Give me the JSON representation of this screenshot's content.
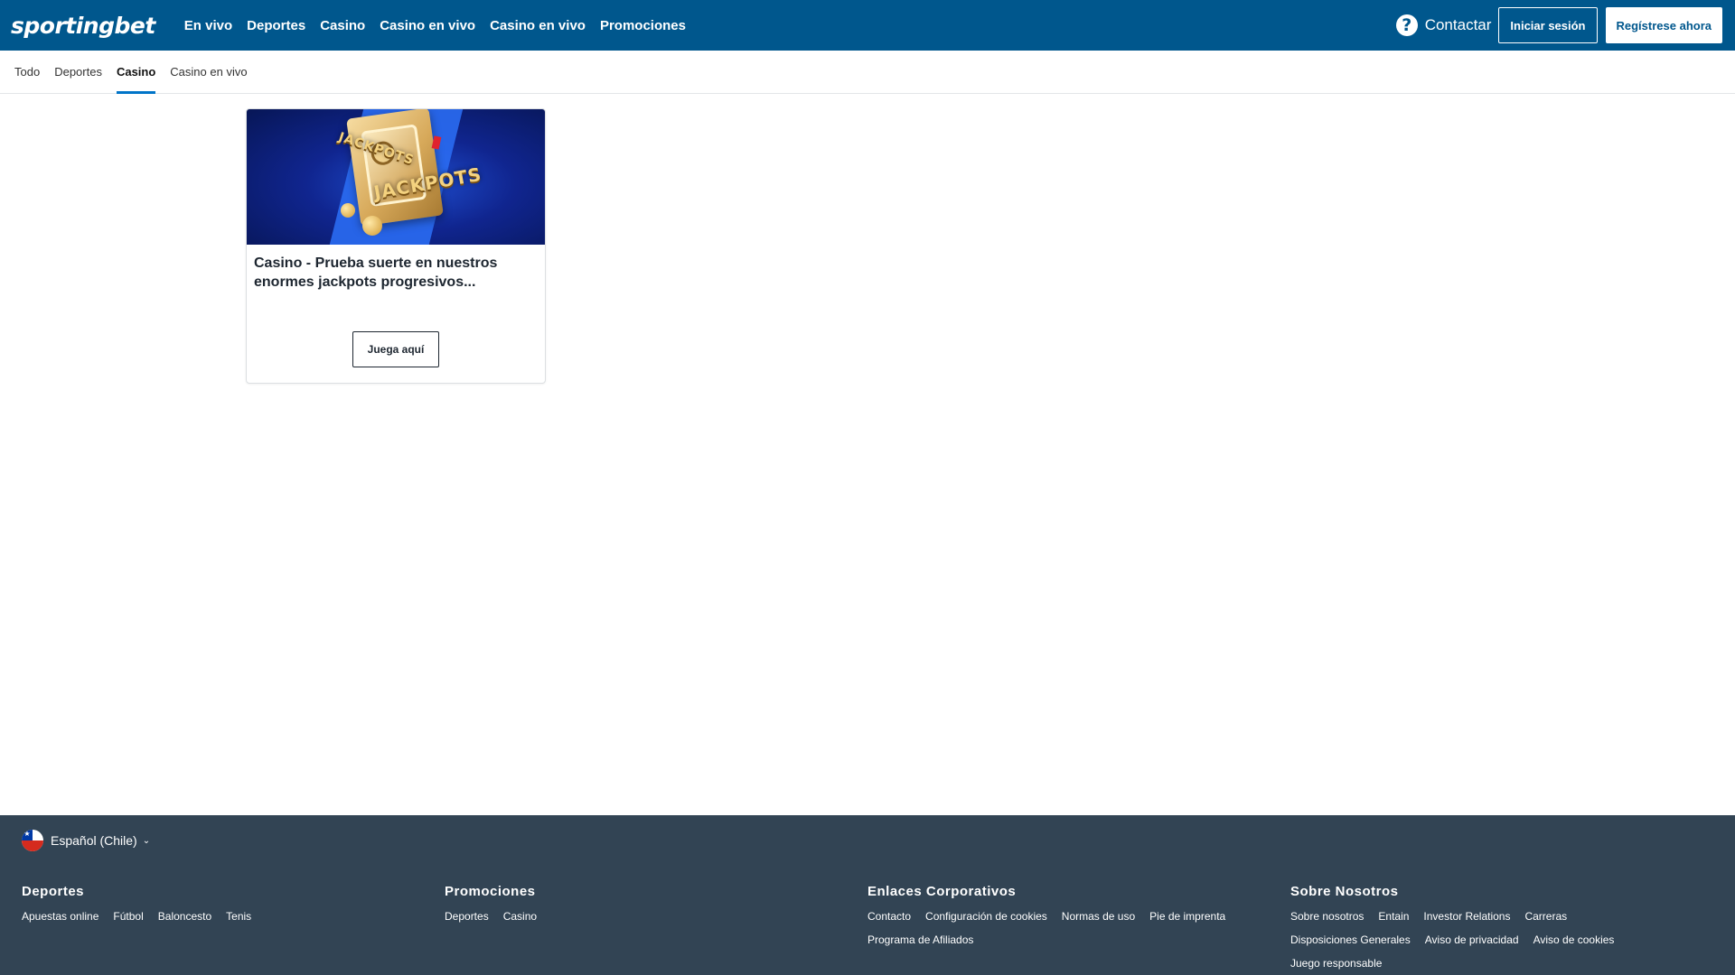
{
  "header": {
    "logo": "sportingbet",
    "nav": [
      "En vivo",
      "Deportes",
      "Casino",
      "Casino en vivo",
      "Casino en vivo",
      "Promociones"
    ],
    "help_label": "Contactar",
    "login_label": "Iniciar sesión",
    "register_label": "Regístrese ahora",
    "brand_color": "#00578d"
  },
  "subtabs": {
    "items": [
      "Todo",
      "Deportes",
      "Casino",
      "Casino en vivo"
    ],
    "active": "Casino"
  },
  "promo_card": {
    "image_text_small": "JACKPOTS",
    "image_text_large": "JACKPOTS",
    "title": "Casino - Prueba suerte en nuestros enormes jackpots progresivos...",
    "button_label": "Juega aquí"
  },
  "footer": {
    "language": "Español (Chile)",
    "background": "#324454",
    "columns": [
      {
        "title": "Deportes",
        "links": [
          "Apuestas online",
          "Fútbol",
          "Baloncesto",
          "Tenis"
        ]
      },
      {
        "title": "Promociones",
        "links": [
          "Deportes",
          "Casino"
        ]
      },
      {
        "title": "Enlaces Corporativos",
        "links": [
          "Contacto",
          "Configuración de cookies",
          "Normas de uso",
          "Pie de imprenta",
          "Programa de Afiliados"
        ]
      },
      {
        "title": "Sobre Nosotros",
        "links": [
          "Sobre nosotros",
          "Entain",
          "Investor Relations",
          "Carreras",
          "Disposiciones Generales",
          "Aviso de privacidad",
          "Aviso de cookies",
          "Juego responsable"
        ]
      }
    ]
  }
}
